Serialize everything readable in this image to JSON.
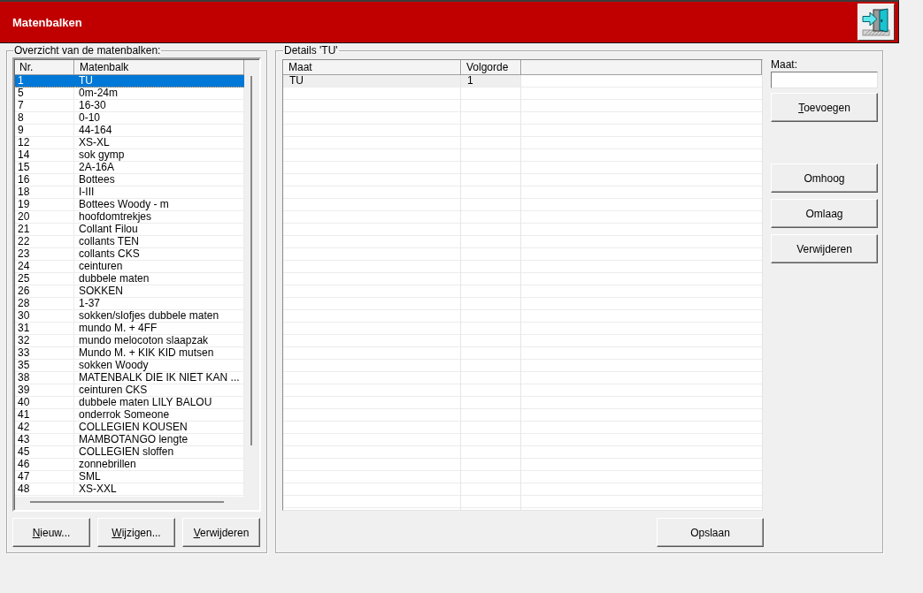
{
  "window": {
    "title": "Matenbalken"
  },
  "overview": {
    "title": "Overzicht van de matenbalken:",
    "columns": [
      "Nr.",
      "Matenbalk"
    ],
    "rows": [
      {
        "nr": "1",
        "matenbalk": "TU",
        "selected": true
      },
      {
        "nr": "5",
        "matenbalk": "0m-24m",
        "selected": false
      },
      {
        "nr": "7",
        "matenbalk": "16-30",
        "selected": false
      },
      {
        "nr": "8",
        "matenbalk": "0-10",
        "selected": false
      },
      {
        "nr": "9",
        "matenbalk": "44-164",
        "selected": false
      },
      {
        "nr": "12",
        "matenbalk": "XS-XL",
        "selected": false
      },
      {
        "nr": "14",
        "matenbalk": "sok gymp",
        "selected": false
      },
      {
        "nr": "15",
        "matenbalk": "2A-16A",
        "selected": false
      },
      {
        "nr": "16",
        "matenbalk": "Bottees",
        "selected": false
      },
      {
        "nr": "18",
        "matenbalk": "I-III",
        "selected": false
      },
      {
        "nr": "19",
        "matenbalk": "Bottees Woody - m",
        "selected": false
      },
      {
        "nr": "20",
        "matenbalk": "hoofdomtrekjes",
        "selected": false
      },
      {
        "nr": "21",
        "matenbalk": "Collant Filou",
        "selected": false
      },
      {
        "nr": "22",
        "matenbalk": "collants TEN",
        "selected": false
      },
      {
        "nr": "23",
        "matenbalk": "collants CKS",
        "selected": false
      },
      {
        "nr": "24",
        "matenbalk": "ceinturen",
        "selected": false
      },
      {
        "nr": "25",
        "matenbalk": "dubbele maten",
        "selected": false
      },
      {
        "nr": "26",
        "matenbalk": "SOKKEN",
        "selected": false
      },
      {
        "nr": "28",
        "matenbalk": "1-37",
        "selected": false
      },
      {
        "nr": "30",
        "matenbalk": "sokken/slofjes dubbele maten",
        "selected": false
      },
      {
        "nr": "31",
        "matenbalk": "mundo M. + 4FF",
        "selected": false
      },
      {
        "nr": "32",
        "matenbalk": "mundo melocoton slaapzak",
        "selected": false
      },
      {
        "nr": "33",
        "matenbalk": "Mundo M. + KIK KID mutsen",
        "selected": false
      },
      {
        "nr": "35",
        "matenbalk": "sokken Woody",
        "selected": false
      },
      {
        "nr": "38",
        "matenbalk": "MATENBALK DIE IK NIET KAN ...",
        "selected": false
      },
      {
        "nr": "39",
        "matenbalk": "ceinturen CKS",
        "selected": false
      },
      {
        "nr": "40",
        "matenbalk": "dubbele maten LILY BALOU",
        "selected": false
      },
      {
        "nr": "41",
        "matenbalk": "onderrok Someone",
        "selected": false
      },
      {
        "nr": "42",
        "matenbalk": "COLLEGIEN KOUSEN",
        "selected": false
      },
      {
        "nr": "43",
        "matenbalk": "MAMBOTANGO lengte",
        "selected": false
      },
      {
        "nr": "45",
        "matenbalk": "COLLEGIEN sloffen",
        "selected": false
      },
      {
        "nr": "46",
        "matenbalk": "zonnebrillen",
        "selected": false
      },
      {
        "nr": "47",
        "matenbalk": "SML",
        "selected": false
      },
      {
        "nr": "48",
        "matenbalk": "XS-XXL",
        "selected": false
      }
    ],
    "buttons": [
      {
        "label": "Nieuw...",
        "mnemonic": true
      },
      {
        "label": "Wijzigen...",
        "mnemonic": true
      },
      {
        "label": "Verwijderen",
        "mnemonic": true
      }
    ]
  },
  "details": {
    "title": "Details 'TU'",
    "columns": [
      "Maat",
      "Volgorde"
    ],
    "rows": [
      {
        "maat": "TU",
        "volgorde": "1",
        "selected": true
      }
    ],
    "field": {
      "label": "Maat:"
    },
    "add_button": {
      "label": "Toevoegen",
      "mnemonic": true
    },
    "order_buttons": [
      {
        "label": "Omhoog",
        "mnemonic": false
      },
      {
        "label": "Omlaag",
        "mnemonic": false
      },
      {
        "label": "Verwijderen",
        "mnemonic": false
      }
    ],
    "save_button": {
      "label": "Opslaan",
      "mnemonic": false
    }
  }
}
